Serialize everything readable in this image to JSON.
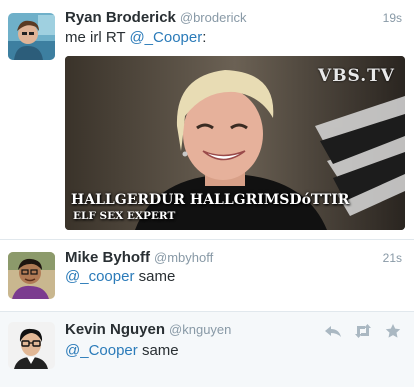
{
  "tweets": [
    {
      "name": "Ryan Broderick",
      "handle": "@broderick",
      "time": "19s",
      "text_prefix": "me irl RT ",
      "mention": "@_Cooper",
      "text_suffix": ":",
      "media": {
        "logo": "VBS.TV",
        "caption_line1": "HALLGERDUR HALLGRIMSDóTTIR",
        "caption_line2": "ELF SEX EXPERT"
      }
    },
    {
      "name": "Mike Byhoff",
      "handle": "@mbyhoff",
      "time": "21s",
      "mention": "@_cooper",
      "text_suffix": " same"
    },
    {
      "name": "Kevin Nguyen",
      "handle": "@knguyen",
      "mention": "@_Cooper",
      "text_suffix": " same",
      "actions": {
        "reply_icon": "reply-icon",
        "retweet_icon": "retweet-icon",
        "favorite_icon": "star-icon"
      }
    }
  ],
  "colors": {
    "link": "#2b7bb9",
    "meta": "#8899a6",
    "text": "#292f33"
  }
}
